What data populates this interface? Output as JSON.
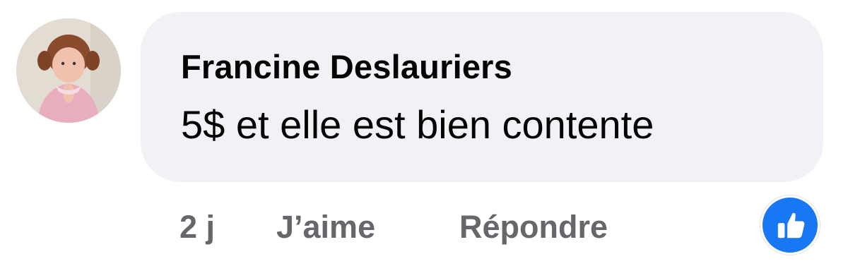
{
  "comment": {
    "author": "Francine Deslauriers",
    "text": "5$ et elle est bien contente",
    "avatar_icon": "profile-photo-avatar",
    "actions": {
      "time": "2 j",
      "like_label": "J’aime",
      "reply_label": "Répondre"
    },
    "reaction": {
      "icon": "thumbs-up-icon",
      "color": "#1877f2"
    }
  },
  "colors": {
    "bubble_bg": "#f0f2f5",
    "text": "#050505",
    "secondary_text": "#65676b",
    "reaction_blue": "#1877f2"
  }
}
